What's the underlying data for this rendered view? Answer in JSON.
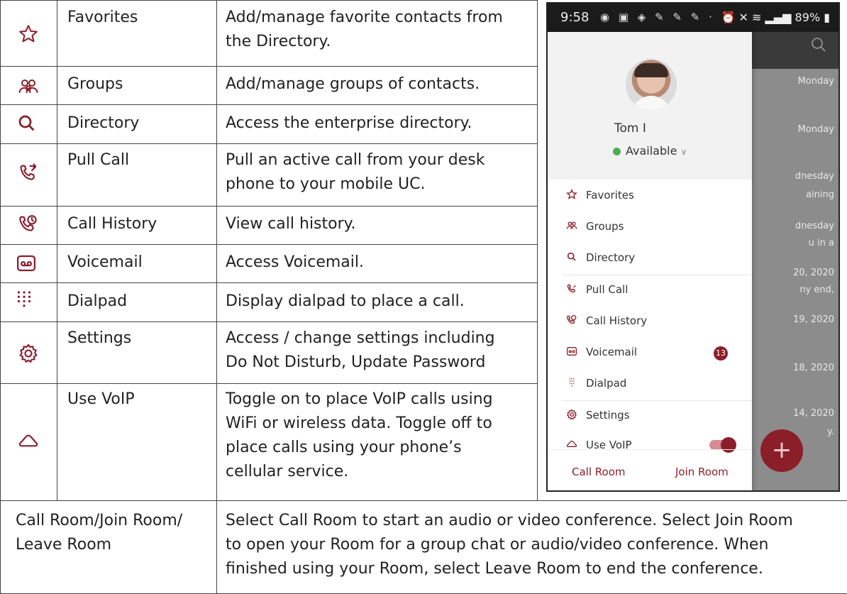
{
  "rows": [
    {
      "icon": "star-icon",
      "name": "Favorites",
      "desc_lines": [
        "Add/manage favorite contacts from",
        "the Directory."
      ]
    },
    {
      "icon": "groups-icon",
      "name": "Groups",
      "desc_lines": [
        "Add/manage groups of contacts."
      ]
    },
    {
      "icon": "search-icon",
      "name": "Directory",
      "desc_lines": [
        "Access the enterprise directory."
      ]
    },
    {
      "icon": "pull-call-icon",
      "name": "Pull Call",
      "desc_lines": [
        "Pull an active call from your desk",
        "phone to your mobile UC."
      ]
    },
    {
      "icon": "call-history-icon",
      "name": "Call History",
      "desc_lines": [
        "View call history."
      ]
    },
    {
      "icon": "voicemail-icon",
      "name": "Voicemail",
      "desc_lines": [
        "Access Voicemail."
      ]
    },
    {
      "icon": "dialpad-icon",
      "name": "Dialpad",
      "desc_lines": [
        "Display dialpad to place a call."
      ]
    },
    {
      "icon": "settings-gear-icon",
      "name": "Settings",
      "desc_lines": [
        "Access / change settings including",
        "Do Not Disturb, Update Password"
      ]
    },
    {
      "icon": "cloud-icon",
      "name": "Use VoIP",
      "desc_lines": [
        "Toggle on to place VoIP calls using",
        "WiFi or wireless data.  Toggle off to",
        "place calls using your phone’s",
        "cellular service."
      ]
    }
  ],
  "bottom_row": {
    "name_lines": [
      "Call Room/Join Room/",
      "Leave Room"
    ],
    "desc_lines": [
      "Select Call Room to start an audio or video conference.  Select Join Room",
      "to open your Room for a group chat or audio/video conference.  When",
      "finished using your Room, select Leave Room to end the conference."
    ]
  },
  "phone": {
    "status_time": "9:58",
    "status_battery": "89%",
    "user_name": "Tom I",
    "status": "Available",
    "status_chevron": "∨",
    "badge_count": "13",
    "menu": [
      {
        "icon": "star-icon",
        "label": "Favorites"
      },
      {
        "icon": "groups-icon",
        "label": "Groups"
      },
      {
        "icon": "search-icon",
        "label": "Directory"
      },
      {
        "icon": "pull-call-icon",
        "label": "Pull Call"
      },
      {
        "icon": "call-history-icon",
        "label": "Call History"
      },
      {
        "icon": "voicemail-icon",
        "label": "Voicemail"
      },
      {
        "icon": "dialpad-icon",
        "label": "Dialpad"
      },
      {
        "icon": "settings-gear-icon",
        "label": "Settings"
      },
      {
        "icon": "cloud-icon",
        "label": "Use VoIP"
      }
    ],
    "voip_toggle_on": true,
    "call_room": "Call Room",
    "join_room": "Join Room",
    "background_text": [
      "Monday",
      "Monday",
      "dnesday",
      "aining",
      "dnesday",
      "u in a",
      "20, 2020",
      "ny end,",
      "19, 2020",
      "18, 2020",
      "14, 2020",
      "y."
    ]
  },
  "colors": {
    "accent": "#8a1f2a",
    "icon_red": "#8b1e2b",
    "available_green": "#4caf50"
  }
}
